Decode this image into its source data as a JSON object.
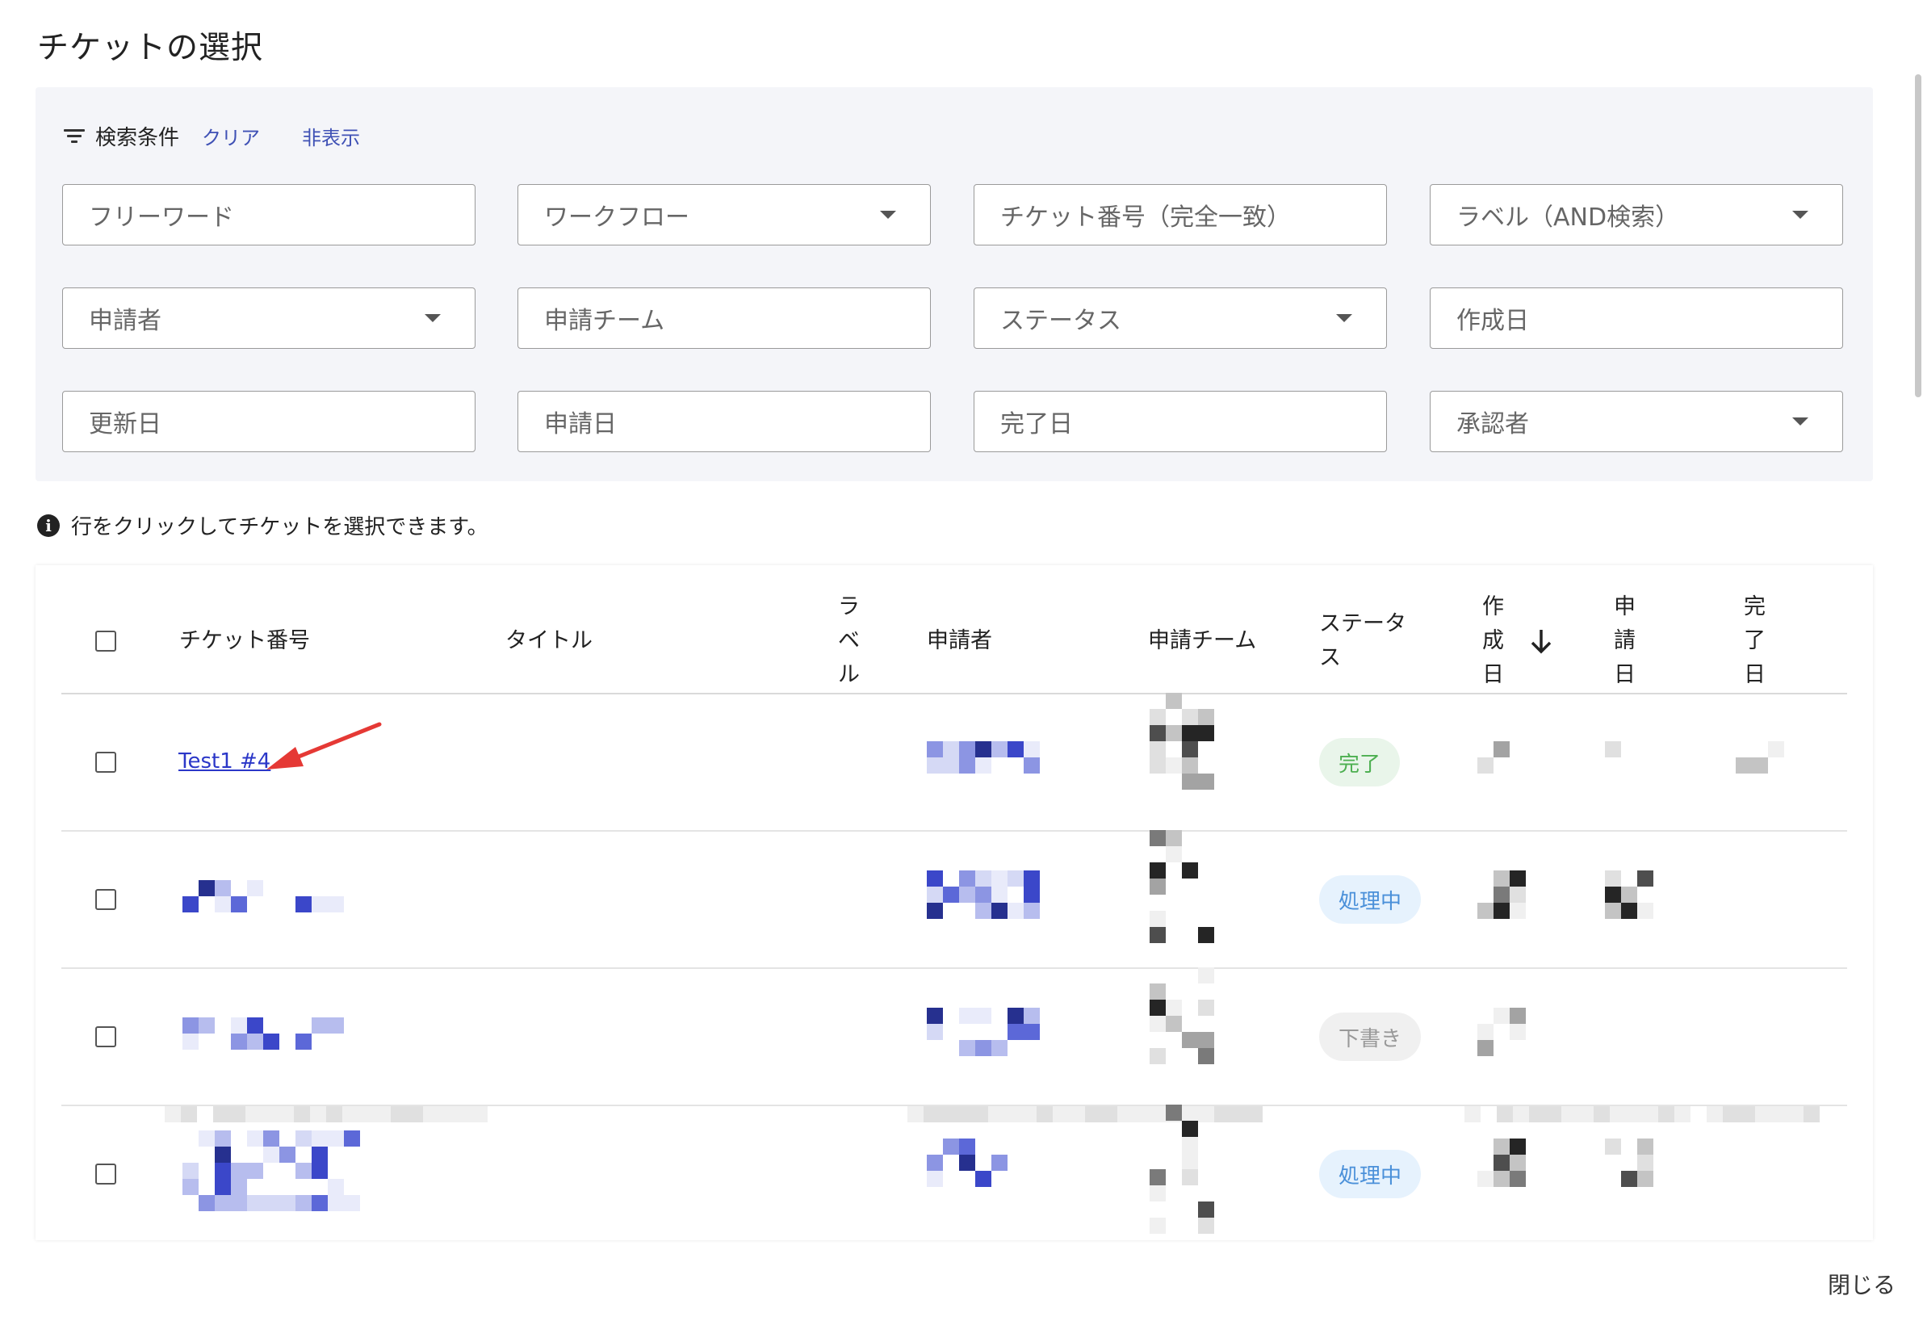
{
  "dialog": {
    "title": "チケットの選択",
    "close_label": "閉じる"
  },
  "search": {
    "filter_icon": "filter-list-icon",
    "label": "検索条件",
    "clear_label": "クリア",
    "hide_label": "非表示",
    "fields": [
      {
        "placeholder": "フリーワード",
        "dropdown": false
      },
      {
        "placeholder": "ワークフロー",
        "dropdown": true
      },
      {
        "placeholder": "チケット番号（完全一致）",
        "dropdown": false
      },
      {
        "placeholder": "ラベル（AND検索）",
        "dropdown": true
      },
      {
        "placeholder": "申請者",
        "dropdown": true
      },
      {
        "placeholder": "申請チーム",
        "dropdown": false
      },
      {
        "placeholder": "ステータス",
        "dropdown": true
      },
      {
        "placeholder": "作成日",
        "dropdown": false
      },
      {
        "placeholder": "更新日",
        "dropdown": false
      },
      {
        "placeholder": "申請日",
        "dropdown": false
      },
      {
        "placeholder": "完了日",
        "dropdown": false
      },
      {
        "placeholder": "承認者",
        "dropdown": true
      }
    ]
  },
  "info": {
    "icon": "info-icon",
    "text": "行をクリックしてチケットを選択できます。"
  },
  "table": {
    "headers": {
      "ticket_number": "チケット番号",
      "title": "タイトル",
      "label": "ラベル",
      "applicant": "申請者",
      "team": "申請チーム",
      "status": "ステータス",
      "created": "作成日",
      "applied": "申請日",
      "completed": "完了日"
    },
    "sort_icon": "arrow-down-icon",
    "rows": [
      {
        "ticket": "Test1 #4",
        "status": "完了",
        "status_type": "done"
      },
      {
        "ticket": "",
        "status": "処理中",
        "status_type": "progress"
      },
      {
        "ticket": "",
        "status": "下書き",
        "status_type": "draft"
      },
      {
        "ticket": "",
        "status": "処理中",
        "status_type": "progress"
      }
    ]
  },
  "colors": {
    "accent": "#3f51b5",
    "annotation_arrow": "#e53935",
    "status_done": "#4caf50",
    "status_progress": "#4a90d9"
  }
}
